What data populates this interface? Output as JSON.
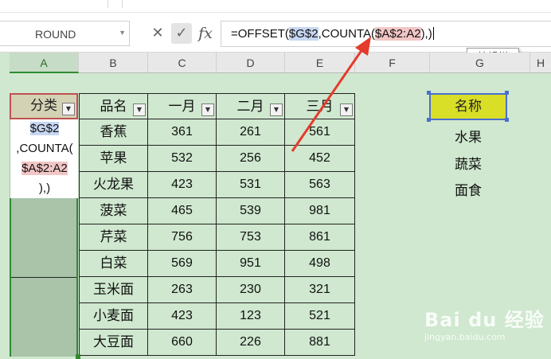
{
  "name_box": {
    "value": "ROUND"
  },
  "formula_bar": {
    "cancel_icon": "close-icon",
    "confirm_icon": "check-icon",
    "fx_label": "fx",
    "formula_prefix": "=OFFSET(",
    "ref_g": "$G$2",
    "mid": ",COUNTA(",
    "ref_a": "$A$2:A2",
    "suffix": "),)"
  },
  "tooltip": {
    "label": "编辑栏"
  },
  "columns": [
    "A",
    "B",
    "C",
    "D",
    "E",
    "F",
    "G",
    "H"
  ],
  "table": {
    "headers": [
      "分类",
      "品名",
      "一月",
      "二月",
      "三月"
    ],
    "rows": [
      [
        "香蕉",
        "361",
        "261",
        "561"
      ],
      [
        "苹果",
        "532",
        "256",
        "452"
      ],
      [
        "火龙果",
        "423",
        "531",
        "563"
      ],
      [
        "菠菜",
        "465",
        "539",
        "981"
      ],
      [
        "芹菜",
        "756",
        "753",
        "861"
      ],
      [
        "白菜",
        "569",
        "951",
        "498"
      ],
      [
        "玉米面",
        "263",
        "230",
        "321"
      ],
      [
        "小麦面",
        "423",
        "123",
        "521"
      ],
      [
        "大豆面",
        "660",
        "226",
        "881"
      ]
    ]
  },
  "cell_edit": {
    "line1": "$G$2",
    "line2a": ",COUNTA(",
    "line3": "$A$2:A2",
    "line4": "),)"
  },
  "lookup": {
    "header": "名称",
    "items": [
      "水果",
      "蔬菜",
      "面食"
    ]
  },
  "watermark": {
    "brand": "Bai du 经验",
    "url": "jingyan.baidu.com"
  },
  "colors": {
    "grid_bg": "#cfe8cf",
    "accent_green": "#2f8a2f",
    "annotation_red": "#e53b2c",
    "name_header_yellow": "#d8df26"
  }
}
